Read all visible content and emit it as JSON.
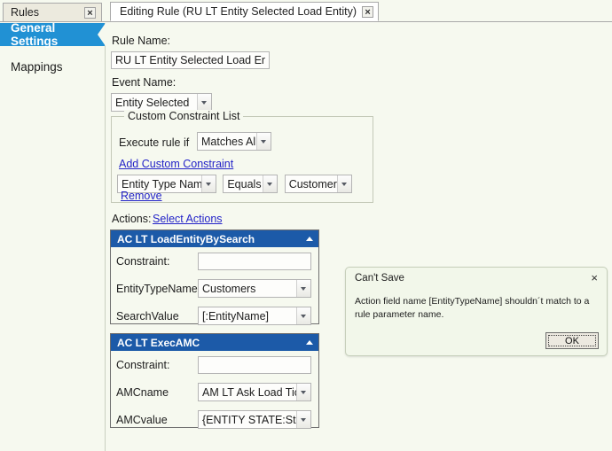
{
  "tabs": [
    {
      "label": "Rules",
      "active": false,
      "close": "×"
    },
    {
      "label": "Editing Rule (RU LT Entity Selected Load Entity)",
      "active": true,
      "close": "×"
    }
  ],
  "sidebar": {
    "items": [
      {
        "label": "General Settings",
        "selected": true
      },
      {
        "label": "Mappings",
        "selected": false
      }
    ]
  },
  "form": {
    "rule_name_label": "Rule Name:",
    "rule_name_value": "RU LT Entity Selected Load Entity",
    "event_name_label": "Event Name:",
    "event_name_value": "Entity Selected"
  },
  "constraint_group": {
    "legend": "Custom Constraint List",
    "execute_label": "Execute rule if",
    "execute_value": "Matches All",
    "add_link": "Add Custom Constraint",
    "rows": [
      {
        "field": "Entity Type Name",
        "operator": "Equals",
        "value": "Customers",
        "remove_label": "Remove"
      }
    ]
  },
  "actions": {
    "label": "Actions:",
    "select_link": "Select Actions",
    "panels": [
      {
        "title": "AC LT LoadEntityBySearch",
        "rows": [
          {
            "label": "Constraint:",
            "type": "text",
            "value": ""
          },
          {
            "label": "EntityTypeName",
            "type": "select",
            "value": "Customers"
          },
          {
            "label": "SearchValue",
            "type": "select",
            "value": "[:EntityName]"
          }
        ]
      },
      {
        "title": "AC LT ExecAMC",
        "rows": [
          {
            "label": "Constraint:",
            "type": "text",
            "value": ""
          },
          {
            "label": "AMCname",
            "type": "select",
            "value": "AM LT Ask Load Ticket"
          },
          {
            "label": "AMCvalue",
            "type": "select",
            "value": "{ENTITY STATE:Status}"
          }
        ]
      }
    ]
  },
  "dialog": {
    "title": "Can't Save",
    "close": "×",
    "message": "Action field name [EntityTypeName] shouldn´t match to a rule parameter name.",
    "ok_label": "OK"
  },
  "colors": {
    "accent_blue": "#2191d4",
    "panel_header_blue": "#1c5aa8",
    "background": "#f6f9ef",
    "link": "#2323c8"
  }
}
